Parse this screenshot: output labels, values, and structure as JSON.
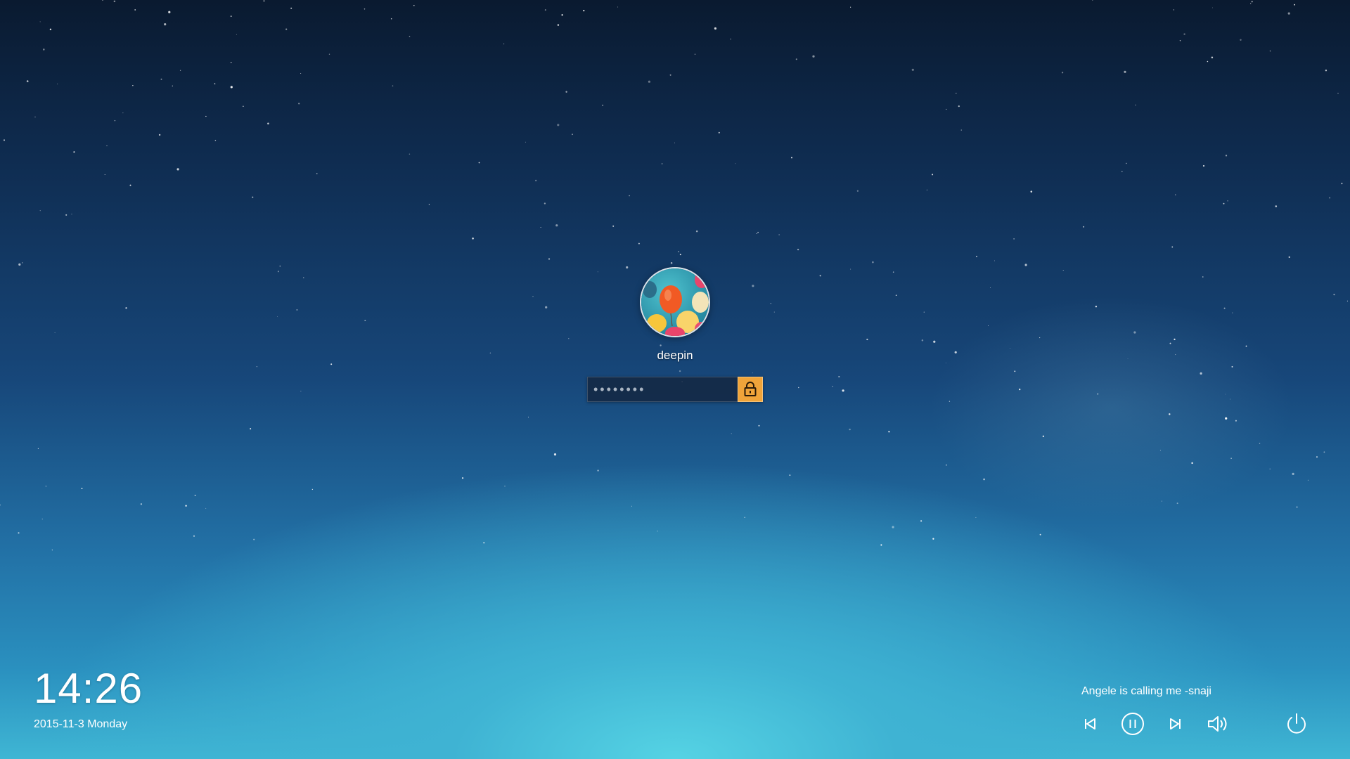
{
  "user": {
    "name": "deepin",
    "password_mask": "••••••••"
  },
  "clock": {
    "time": "14:26",
    "date": "2015-11-3 Monday"
  },
  "media": {
    "track": "Angele is calling me -snaji"
  },
  "icons": {
    "unlock": "lock-icon",
    "previous": "skip-previous-icon",
    "pause": "pause-circle-icon",
    "next": "skip-next-icon",
    "volume": "volume-icon",
    "power": "power-icon"
  },
  "colors": {
    "accent": "#f0a43a",
    "text": "#ffffff",
    "sky_top": "#0a1a30",
    "sky_bottom": "#3fb6d4"
  }
}
